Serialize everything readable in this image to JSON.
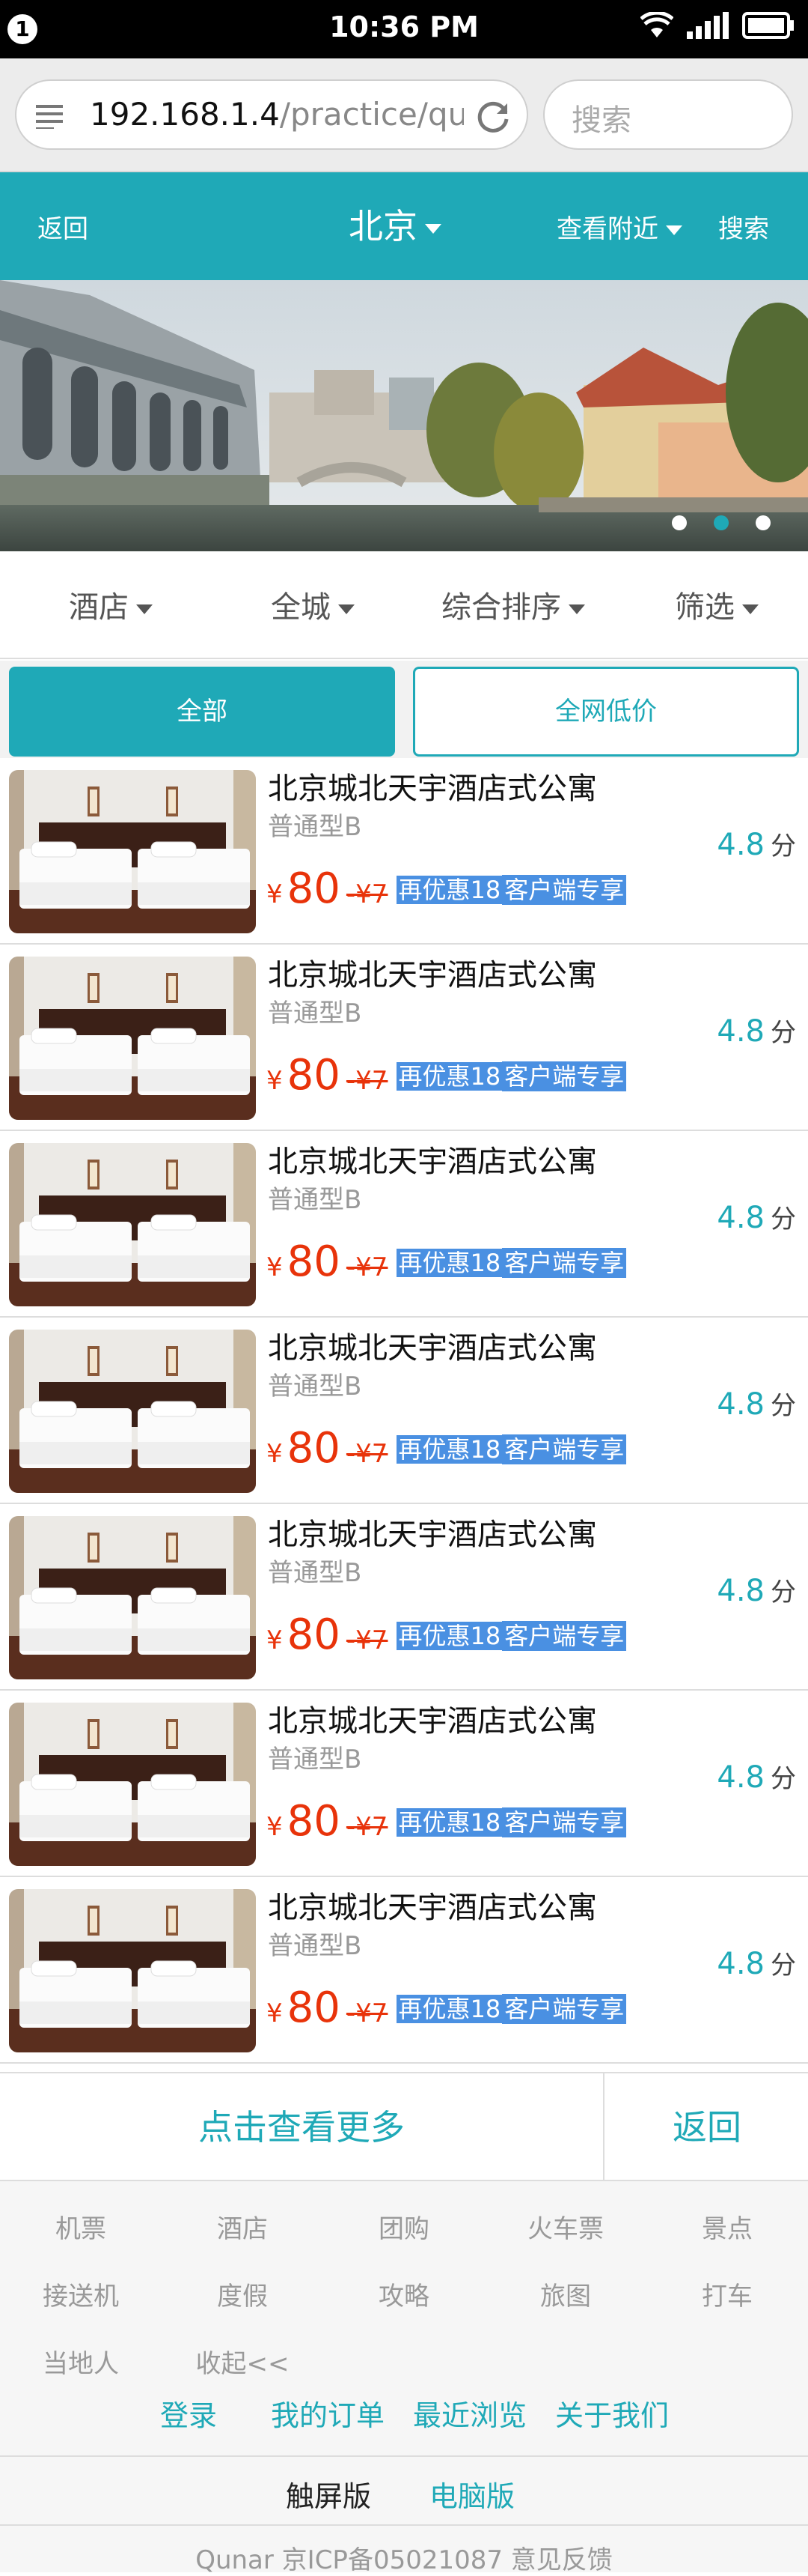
{
  "status_bar": {
    "notification_count": "1",
    "time": "10:36 PM"
  },
  "browser": {
    "url_host": "192.168.1.4",
    "url_path": "/practice/qunar",
    "search_placeholder": "搜索"
  },
  "header": {
    "back": "返回",
    "city": "北京",
    "nearby": "查看附近",
    "search": "搜索"
  },
  "banner": {
    "dots": 3
  },
  "filters": [
    "酒店",
    "全城",
    "综合排序",
    "筛选"
  ],
  "tabs": {
    "all": "全部",
    "lowest": "全网低价"
  },
  "hotels": [
    {
      "name": "北京城北天宇酒店式公寓",
      "room": "普通型B",
      "currency": "¥",
      "price": "80",
      "discount": "-¥7",
      "promo": "再优惠18",
      "promo_tag": "客户端专享",
      "score": "4.8",
      "score_unit": "分"
    },
    {
      "name": "北京城北天宇酒店式公寓",
      "room": "普通型B",
      "currency": "¥",
      "price": "80",
      "discount": "-¥7",
      "promo": "再优惠18",
      "promo_tag": "客户端专享",
      "score": "4.8",
      "score_unit": "分"
    },
    {
      "name": "北京城北天宇酒店式公寓",
      "room": "普通型B",
      "currency": "¥",
      "price": "80",
      "discount": "-¥7",
      "promo": "再优惠18",
      "promo_tag": "客户端专享",
      "score": "4.8",
      "score_unit": "分"
    },
    {
      "name": "北京城北天宇酒店式公寓",
      "room": "普通型B",
      "currency": "¥",
      "price": "80",
      "discount": "-¥7",
      "promo": "再优惠18",
      "promo_tag": "客户端专享",
      "score": "4.8",
      "score_unit": "分"
    },
    {
      "name": "北京城北天宇酒店式公寓",
      "room": "普通型B",
      "currency": "¥",
      "price": "80",
      "discount": "-¥7",
      "promo": "再优惠18",
      "promo_tag": "客户端专享",
      "score": "4.8",
      "score_unit": "分"
    },
    {
      "name": "北京城北天宇酒店式公寓",
      "room": "普通型B",
      "currency": "¥",
      "price": "80",
      "discount": "-¥7",
      "promo": "再优惠18",
      "promo_tag": "客户端专享",
      "score": "4.8",
      "score_unit": "分"
    },
    {
      "name": "北京城北天宇酒店式公寓",
      "room": "普通型B",
      "currency": "¥",
      "price": "80",
      "discount": "-¥7",
      "promo": "再优惠18",
      "promo_tag": "客户端专享",
      "score": "4.8",
      "score_unit": "分"
    }
  ],
  "more": {
    "load_more": "点击查看更多",
    "back": "返回"
  },
  "footer": {
    "links": [
      "机票",
      "酒店",
      "团购",
      "火车票",
      "景点",
      "接送机",
      "度假",
      "攻略",
      "旅图",
      "打车",
      "当地人",
      "收起<<"
    ],
    "user_links": [
      "登录",
      "我的订单",
      "最近浏览",
      "关于我们"
    ],
    "touch_version": "触屏版",
    "pc_version": "电脑版",
    "icp": "Qunar 京ICP备05021087 意见反馈"
  },
  "colors": {
    "brand": "#1fa9b7",
    "price": "#e8330a",
    "promo": "#4a90e2"
  }
}
